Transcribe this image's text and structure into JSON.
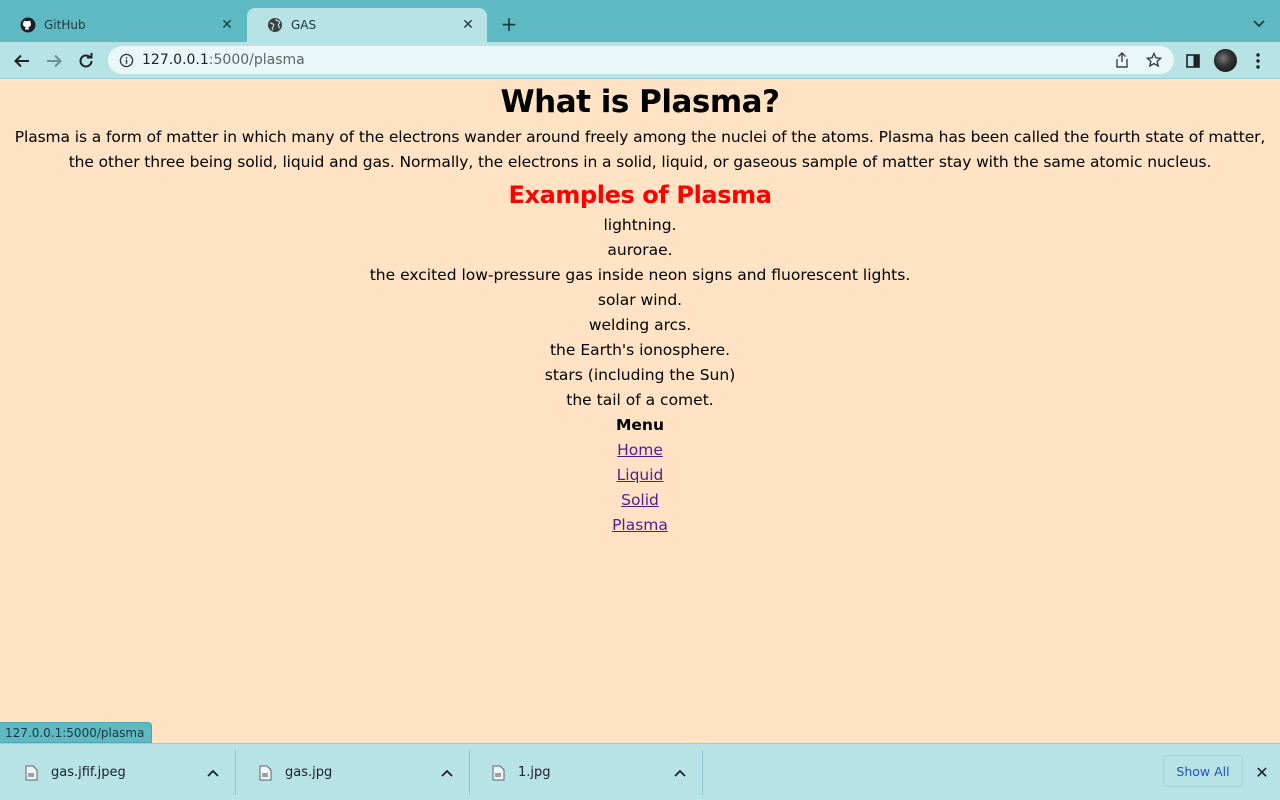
{
  "browser": {
    "tabs": [
      {
        "title": "GitHub",
        "icon": "github-icon",
        "active": false
      },
      {
        "title": "GAS",
        "icon": "globe-icon",
        "active": true
      }
    ],
    "url_host": "127.0.0.1",
    "url_path": ":5000/plasma"
  },
  "content": {
    "heading": "What is Plasma?",
    "intro": "Plasma is a form of matter in which many of the electrons wander around freely among the nuclei of the atoms. Plasma has been called the fourth state of matter, the other three being solid, liquid and gas. Normally, the electrons in a solid, liquid, or gaseous sample of matter stay with the same atomic nucleus.",
    "examples_heading": "Examples of Plasma",
    "examples": [
      "lightning.",
      "aurorae.",
      "the excited low-pressure gas inside neon signs and fluorescent lights.",
      "solar wind.",
      "welding arcs.",
      "the Earth's ionosphere.",
      "stars (including the Sun)",
      "the tail of a comet."
    ],
    "menu_title": "Menu",
    "menu_links": [
      "Home",
      "Liquid",
      "Solid",
      "Plasma"
    ]
  },
  "status": {
    "hover_url": "127.0.0.1:5000/plasma"
  },
  "downloads": {
    "items": [
      {
        "name": "gas.jfif.jpeg"
      },
      {
        "name": "gas.jpg"
      },
      {
        "name": "1.jpg"
      }
    ],
    "show_all_label": "Show All"
  },
  "colors": {
    "page_bg": "#ffe3c4",
    "heading2": "#ff0000",
    "link": "#551a8b",
    "browser_frame": "#5fb9c3",
    "toolbar": "#b7e2e6"
  }
}
